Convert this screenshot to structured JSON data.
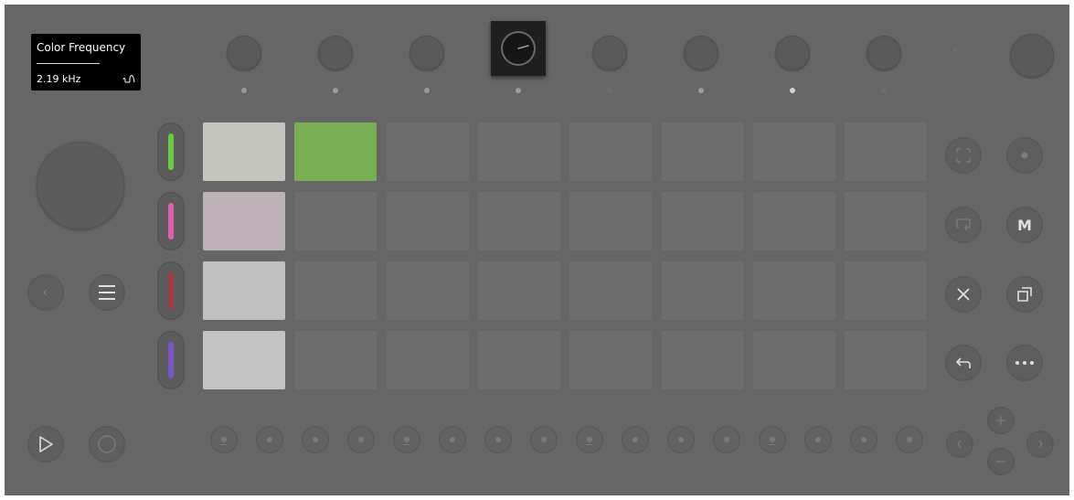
{
  "screen": {
    "title": "Color Frequency",
    "value": "2.19 kHz",
    "icon": "filter-shape-icon"
  },
  "top_knobs": {
    "count": 8,
    "selected_index": 3,
    "indicator_states": [
      "normal",
      "normal",
      "normal",
      "normal",
      "dim",
      "normal",
      "bright",
      "dim"
    ]
  },
  "pad_grid": {
    "rows": 4,
    "columns": 8,
    "colors": [
      [
        "#c5c5c0",
        "#7aae55",
        "#6e6e6e",
        "#6e6e6e",
        "#6e6e6e",
        "#6e6e6e",
        "#6e6e6e",
        "#6e6e6e"
      ],
      [
        "#bdb2b8",
        "#6e6e6e",
        "#6e6e6e",
        "#6e6e6e",
        "#6e6e6e",
        "#6e6e6e",
        "#6e6e6e",
        "#6e6e6e"
      ],
      [
        "#c0c0c0",
        "#6e6e6e",
        "#6e6e6e",
        "#6e6e6e",
        "#6e6e6e",
        "#6e6e6e",
        "#6e6e6e",
        "#6e6e6e"
      ],
      [
        "#c3c3c3",
        "#6e6e6e",
        "#6e6e6e",
        "#6e6e6e",
        "#6e6e6e",
        "#6e6e6e",
        "#6e6e6e",
        "#6e6e6e"
      ]
    ]
  },
  "track_colors": [
    "#6ac93c",
    "#dd5fae",
    "#a43a3a",
    "#7a55c8"
  ],
  "left_controls": {
    "back_icon": "chevron-left-icon",
    "menu_icon": "menu-icon",
    "play_icon": "play-icon",
    "record_icon": "record-icon"
  },
  "right_controls": {
    "capture_icon": "capture-icon",
    "record_dot_icon": "record-dot-icon",
    "loop_icon": "loop-icon",
    "mute_label": "M",
    "clear_icon": "close-icon",
    "duplicate_icon": "duplicate-icon",
    "undo_icon": "undo-icon",
    "more_icon": "more-icon"
  },
  "step_buttons": {
    "count": 16,
    "marked_indices": [
      0,
      4,
      8,
      12
    ]
  },
  "nav": {
    "plus_icon": "plus-icon",
    "minus_icon": "minus-icon",
    "left_icon": "chevron-left-icon",
    "right_icon": "chevron-right-icon"
  }
}
